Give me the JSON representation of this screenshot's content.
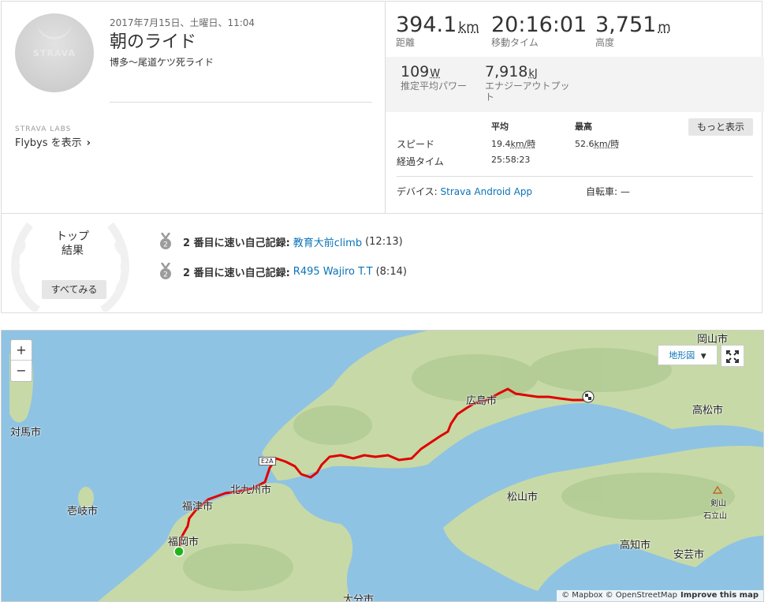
{
  "activity": {
    "date": "2017年7月15日、土曜日、11:04",
    "title": "朝のライド",
    "description": "博多〜尾道ケツ死ライド",
    "avatar_text": "STRAVA"
  },
  "labs": {
    "label": "STRAVA LABS",
    "flybys": "Flybys を表示",
    "chevron": "›"
  },
  "stats": {
    "distance": {
      "value": "394.1",
      "unit": "km",
      "label": "距離"
    },
    "moving_time": {
      "value": "20:16:01",
      "label": "移動タイム"
    },
    "elevation": {
      "value": "3,751",
      "unit": "m",
      "label": "高度"
    },
    "power": {
      "value": "109",
      "unit": "W",
      "label": "推定平均パワー"
    },
    "energy": {
      "value": "7,918",
      "unit": "kJ",
      "label": "エナジーアウトプット"
    }
  },
  "table": {
    "avg_header": "平均",
    "max_header": "最高",
    "more_button": "もっと表示",
    "speed_label": "スピード",
    "speed_avg": "19.4",
    "speed_max": "52.6",
    "speed_unit": "km/時",
    "elapsed_label": "経過タイム",
    "elapsed_value": "25:58:23"
  },
  "device": {
    "label": "デバイス:",
    "value": "Strava Android App"
  },
  "bike": {
    "label": "自転車:",
    "value": "—"
  },
  "top_results": {
    "title_line1": "トップ",
    "title_line2": "結果",
    "all_button": "すべてみる",
    "items": [
      {
        "medal": "2",
        "prefix": "2 番目に速い自己記録:",
        "segment": "教育大前climb",
        "time": "(12:13)"
      },
      {
        "medal": "2",
        "prefix": "2 番目に速い自己記録:",
        "segment": "R495 Wajiro T.T",
        "time": "(8:14)"
      }
    ]
  },
  "map": {
    "zoom_in": "+",
    "zoom_out": "−",
    "map_type": "地形図",
    "map_type_caret": "▼",
    "attribution": "© Mapbox © OpenStreetMap",
    "improve": "Improve this map",
    "route_color": "#e00000",
    "start_color": "#1eb41e",
    "labels": {
      "tsushima": "対馬市",
      "iki": "壱岐市",
      "fukutsu": "福津市",
      "fukuoka": "福岡市",
      "kitakyushu": "北九州市",
      "hiroshima": "広島市",
      "matsuyama": "松山市",
      "takamatsu": "高松市",
      "kochi": "高知市",
      "aki": "安芸市",
      "oita": "大分市",
      "okayama": "岡山市",
      "tsurugi": "剣山",
      "ishiyama": "石立山",
      "e2a": "E2A"
    }
  }
}
